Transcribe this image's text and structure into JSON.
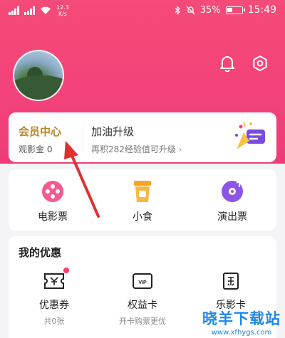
{
  "status_bar": {
    "net_speed_value": "12.3",
    "net_speed_unit": "K/s",
    "battery": "35%",
    "time": "15:49"
  },
  "header": {
    "bell_icon": "bell-icon",
    "settings_icon": "gear-icon"
  },
  "vip": {
    "title": "会员中心",
    "subtitle": "观影金 0",
    "upgrade_title": "加油升级",
    "upgrade_hint": "再积282经验值可升级",
    "chevron": "›"
  },
  "entries": [
    {
      "label": "电影票",
      "icon": "film-reel-icon"
    },
    {
      "label": "小食",
      "icon": "drink-cup-icon"
    },
    {
      "label": "演出票",
      "icon": "music-disc-icon"
    }
  ],
  "benefits": {
    "title": "我的优惠",
    "items": [
      {
        "label": "优惠券",
        "sub": "共0张",
        "icon": "coupon-icon"
      },
      {
        "label": "权益卡",
        "sub": "开卡购票更优",
        "icon": "vip-card-icon",
        "icon_text": "VIP"
      },
      {
        "label": "乐影卡",
        "sub": "",
        "icon": "film-card-icon"
      }
    ]
  },
  "watermark": {
    "title": "晓羊下载站",
    "url": "www.xfhygs.com"
  },
  "colors": {
    "header_pink": "#f3437a",
    "vip_gold": "#b8862c",
    "accent_purple": "#7b4be0",
    "watermark_blue": "#1e88e5",
    "arrow_red": "#e03030"
  }
}
